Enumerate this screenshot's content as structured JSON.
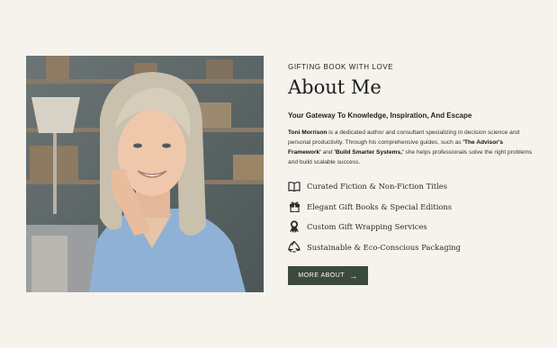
{
  "hero_image": {
    "alt": "Portrait of Toni Morrison"
  },
  "about": {
    "eyebrow": "GIFTING BOOK WITH LOVE",
    "title": "About Me",
    "subtitle": "Your Gateway To Knowledge, Inspiration, And Escape",
    "description": {
      "author": "Toni Morrison",
      "text1": " is a dedicated author and consultant specializing in decision science and personal productivity. Through his comprehensive guides, such as ",
      "book1": "'The Advisor's Framework'",
      "text2": " and ",
      "book2": "'Build Smarter Systems,'",
      "text3": " she helps professionals solve the right problems and build scalable success."
    },
    "features": [
      {
        "icon": "open-book-icon",
        "label": "Curated Fiction & Non-Fiction Titles"
      },
      {
        "icon": "gift-icon",
        "label": "Elegant Gift Books & Special Editions"
      },
      {
        "icon": "ribbon-icon",
        "label": "Custom Gift Wrapping Services"
      },
      {
        "icon": "recycle-icon",
        "label": "Sustainable & Eco-Conscious Packaging"
      }
    ],
    "button": {
      "label": "MORE ABOUT",
      "icon": "arrow-right-icon"
    }
  },
  "colors": {
    "background": "#f5f3ec",
    "button": "#3b4a3a",
    "text": "#1f1f1f"
  }
}
